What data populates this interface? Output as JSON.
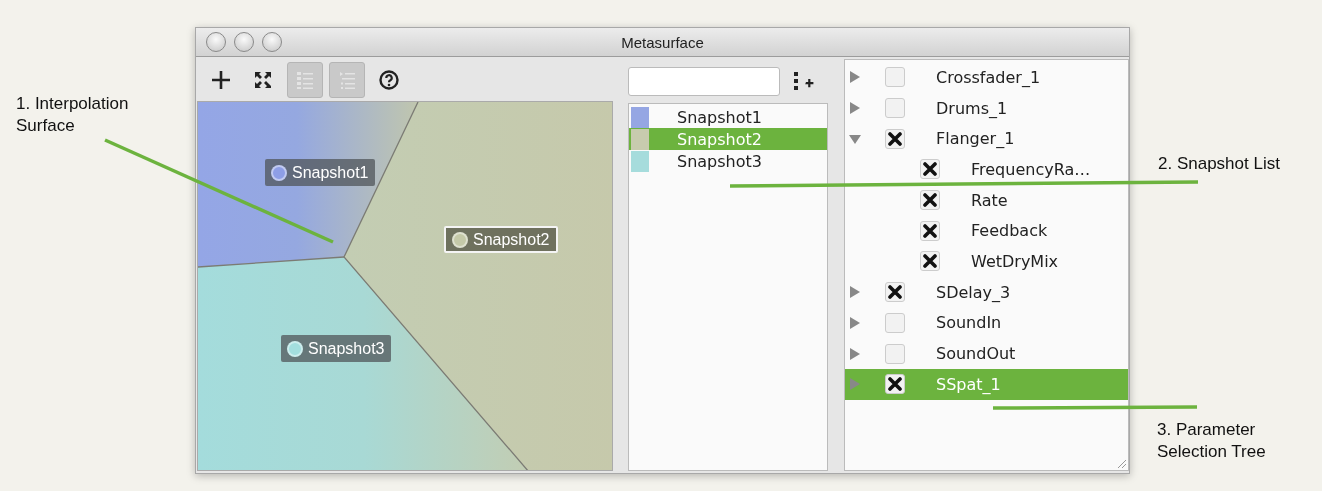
{
  "window": {
    "title": "Metasurface"
  },
  "toolbar": [
    {
      "kind": "add",
      "disabled": false
    },
    {
      "kind": "fit",
      "disabled": false
    },
    {
      "kind": "list",
      "disabled": true
    },
    {
      "kind": "tree",
      "disabled": true
    },
    {
      "kind": "help",
      "disabled": false
    }
  ],
  "surface": {
    "markers": [
      {
        "label": "Snapshot1",
        "color": "#8e9ee6",
        "selected": false
      },
      {
        "label": "Snapshot2",
        "color": "#c4c9a8",
        "selected": true
      },
      {
        "label": "Snapshot3",
        "color": "#a3dede",
        "selected": false
      }
    ]
  },
  "snapshot_list": {
    "items": [
      {
        "label": "Snapshot1",
        "color": "#95a6e3",
        "selected": false
      },
      {
        "label": "Snapshot2",
        "color": "#c7cbae",
        "selected": true
      },
      {
        "label": "Snapshot3",
        "color": "#a6dcdc",
        "selected": false
      }
    ]
  },
  "parameter_tree": {
    "items": [
      {
        "label": "Crossfader_1",
        "checked": false,
        "expanded": false,
        "selected": false
      },
      {
        "label": "Drums_1",
        "checked": false,
        "expanded": false,
        "selected": false
      },
      {
        "label": "Flanger_1",
        "checked": true,
        "expanded": true,
        "selected": false,
        "children": [
          {
            "label": "FrequencyRa…",
            "checked": true,
            "selected": false
          },
          {
            "label": "Rate",
            "checked": true,
            "selected": false
          },
          {
            "label": "Feedback",
            "checked": true,
            "selected": false
          },
          {
            "label": "WetDryMix",
            "checked": true,
            "selected": false
          }
        ]
      },
      {
        "label": "SDelay_3",
        "checked": true,
        "expanded": false,
        "selected": false
      },
      {
        "label": "SoundIn",
        "checked": false,
        "expanded": false,
        "selected": false
      },
      {
        "label": "SoundOut",
        "checked": false,
        "expanded": false,
        "selected": false
      },
      {
        "label": "SSpat_1",
        "checked": true,
        "expanded": false,
        "selected": true
      }
    ]
  },
  "annotations": [
    {
      "label": "1. Interpolation Surface"
    },
    {
      "label": "2. Snapshot List"
    },
    {
      "label": "3. Parameter Selection Tree"
    }
  ]
}
